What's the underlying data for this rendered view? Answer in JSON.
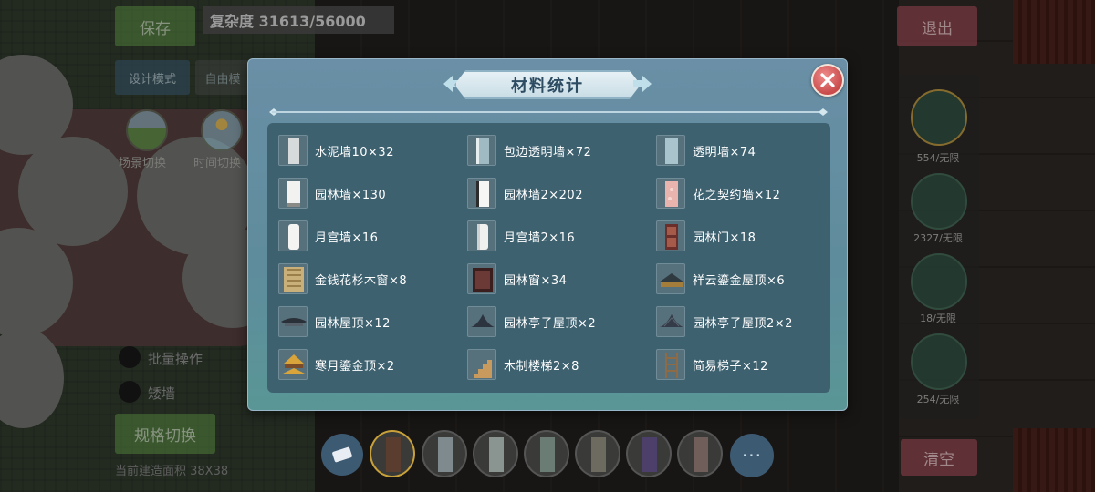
{
  "hud": {
    "save_label": "保存",
    "complexity_text": "复杂度 31613/56000",
    "design_mode_label": "设计模式",
    "free_mode_label": "自由模",
    "scene_switch_label": "场景切换",
    "time_switch_label": "时间切换",
    "batch_label": "批量操作",
    "wall_label": "矮墙",
    "spec_switch_label": "规格切换",
    "build_area_text": "当前建造面积 38X38",
    "exit_label": "退出",
    "clear_label": "清空"
  },
  "side_panel": {
    "items": [
      {
        "count": "554/无限"
      },
      {
        "count": "2327/无限"
      },
      {
        "count": "18/无限"
      },
      {
        "count": "254/无限"
      }
    ]
  },
  "toolbar": {
    "more_label": "···",
    "swatches": [
      "#5a3d2e",
      "#7e8a8e",
      "#8a9592",
      "#6a7c73",
      "#6d6a5f",
      "#4c3f6a",
      "#6f5e5a"
    ]
  },
  "modal": {
    "title": "材料统计",
    "materials": [
      {
        "label": "水泥墙10×32",
        "icon": "cement-wall-icon"
      },
      {
        "label": "包边透明墙×72",
        "icon": "edged-glass-wall-icon"
      },
      {
        "label": "透明墙×74",
        "icon": "glass-wall-icon"
      },
      {
        "label": "园林墙×130",
        "icon": "garden-wall-icon"
      },
      {
        "label": "园林墙2×202",
        "icon": "garden-wall-2-icon"
      },
      {
        "label": "花之契约墙×12",
        "icon": "flower-pact-wall-icon"
      },
      {
        "label": "月宫墙×16",
        "icon": "moon-palace-wall-icon"
      },
      {
        "label": "月宫墙2×16",
        "icon": "moon-palace-wall-2-icon"
      },
      {
        "label": "园林门×18",
        "icon": "garden-door-icon"
      },
      {
        "label": "金钱花杉木窗×8",
        "icon": "fir-window-icon"
      },
      {
        "label": "园林窗×34",
        "icon": "garden-window-icon"
      },
      {
        "label": "祥云鎏金屋顶×6",
        "icon": "cloud-gilded-roof-icon"
      },
      {
        "label": "园林屋顶×12",
        "icon": "garden-roof-icon"
      },
      {
        "label": "园林亭子屋顶×2",
        "icon": "pavilion-roof-icon"
      },
      {
        "label": "园林亭子屋顶2×2",
        "icon": "pavilion-roof-2-icon"
      },
      {
        "label": "寒月鎏金顶×2",
        "icon": "cold-moon-gilded-top-icon"
      },
      {
        "label": "木制楼梯2×8",
        "icon": "wooden-stairs-icon"
      },
      {
        "label": "简易梯子×12",
        "icon": "simple-ladder-icon"
      }
    ]
  },
  "colors": {
    "modal_top": "#6a8fa6",
    "modal_bottom": "#5a9696",
    "content_bg": "#3e6170",
    "close_red": "#c94b4b",
    "title_text": "#2d4c62"
  }
}
